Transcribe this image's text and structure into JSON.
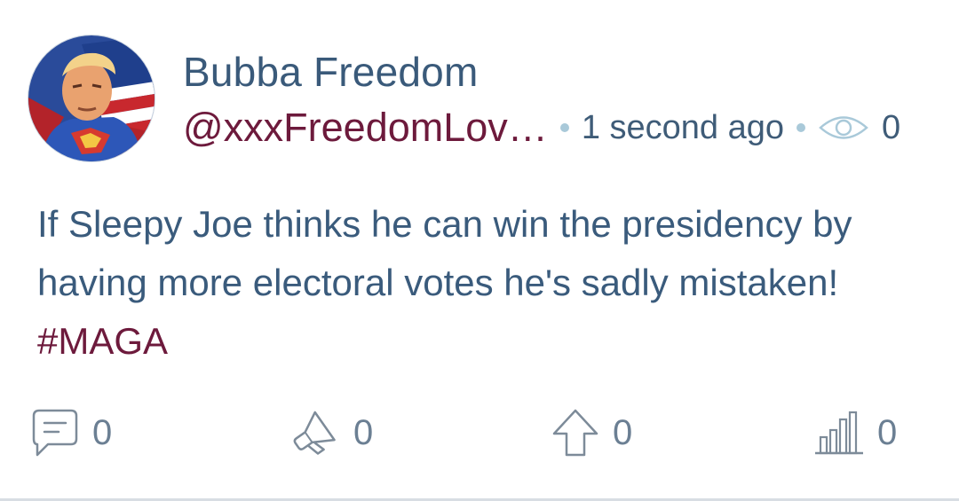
{
  "post": {
    "author": {
      "display_name": "Bubba Freedom",
      "handle": "@xxxFreedomLov…",
      "avatar_icon": "avatar-superhero"
    },
    "timestamp": "1 second ago",
    "views": "0",
    "text": "If Sleepy Joe thinks he can win the presidency by\nhaving more electoral votes he's sadly mistaken!",
    "hashtag": "#MAGA",
    "actions": {
      "replies": "0",
      "reposts": "0",
      "upvotes": "0",
      "stats": "0"
    }
  },
  "colors": {
    "name": "#3a5a7a",
    "handle": "#6d1a3c",
    "body": "#3a5b7c",
    "hashtag": "#6d1a3c",
    "muted": "#6b7f93",
    "dot": "#a9c9d9"
  }
}
